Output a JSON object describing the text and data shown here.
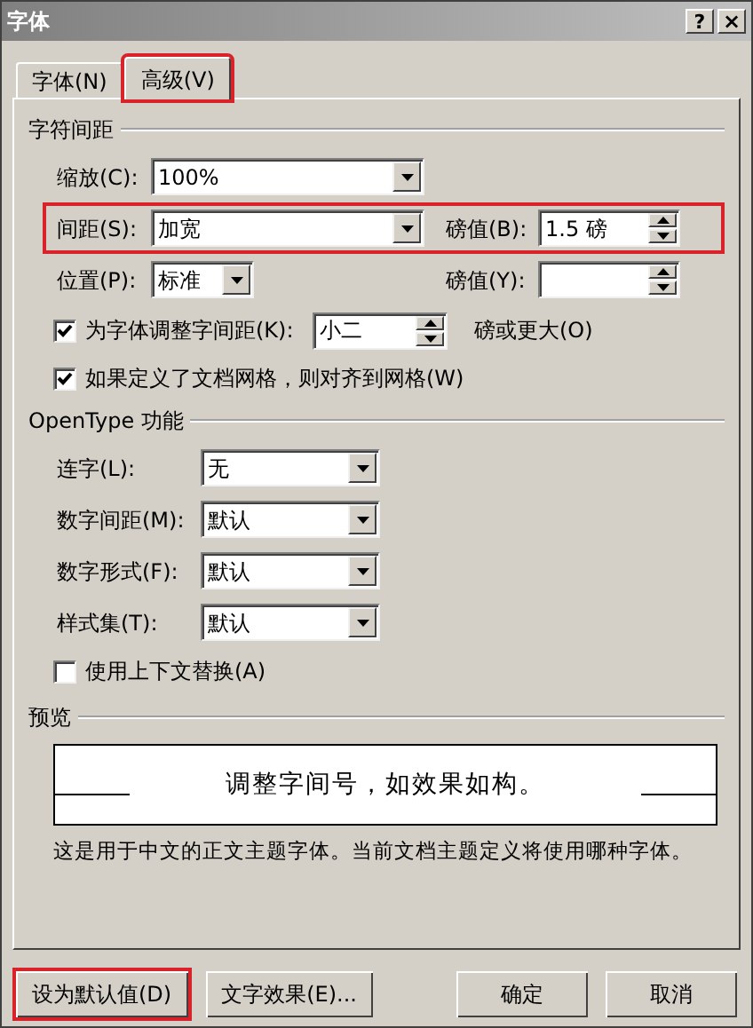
{
  "window": {
    "title": "字体",
    "help_button": "?",
    "close_button": "×"
  },
  "tabs": [
    {
      "label": "字体(N)",
      "selected": false,
      "highlighted": false
    },
    {
      "label": "高级(V)",
      "selected": true,
      "highlighted": true
    }
  ],
  "sections": [
    {
      "kind": "spacing",
      "title": "字符间距",
      "rows": [
        {
          "kind": "dropdown",
          "label": "缩放(C):",
          "value": "100%",
          "highlighted": false
        },
        {
          "kind": "dropdown_spin",
          "label": "间距(S):",
          "value": "加宽",
          "side_label": "磅值(B):",
          "side_value": "1.5 磅",
          "highlighted": true
        },
        {
          "kind": "dropdown_spin",
          "label": "位置(P):",
          "value": "标准",
          "side_label": "磅值(Y):",
          "compact": true,
          "highlighted": false
        },
        {
          "kind": "checkbox_spin",
          "label": "为字体调整字间距(K):",
          "checked": true,
          "value": "小二",
          "suffix": "磅或更大(O)"
        },
        {
          "kind": "checkbox",
          "label": "如果定义了文档网格，则对齐到网格(W)",
          "checked": true
        }
      ]
    },
    {
      "kind": "opentype",
      "title": "OpenType 功能",
      "rows": [
        {
          "kind": "dropdown",
          "label": "连字(L):",
          "value": "无"
        },
        {
          "kind": "dropdown",
          "label": "数字间距(M):",
          "value": "默认"
        },
        {
          "kind": "dropdown",
          "label": "数字形式(F):",
          "value": "默认"
        },
        {
          "kind": "dropdown",
          "label": "样式集(T):",
          "value": "默认"
        },
        {
          "kind": "checkbox",
          "label": "使用上下文替换(A)",
          "checked": false
        }
      ]
    },
    {
      "kind": "preview",
      "title": "预览",
      "preview_text": "调整字间号，如效果如构。",
      "description": "这是用于中文的正文主题字体。当前文档主题定义将使用哪种字体。"
    }
  ],
  "buttons": [
    {
      "label": "设为默认值(D)",
      "highlighted": true
    },
    {
      "label": "文字效果(E)...",
      "highlighted": false
    },
    {
      "label": "确定",
      "highlighted": false
    },
    {
      "label": "取消",
      "highlighted": false
    }
  ]
}
